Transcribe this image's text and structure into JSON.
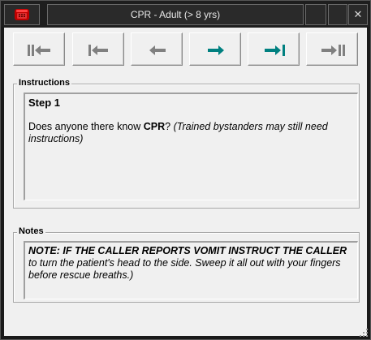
{
  "window": {
    "title": "CPR - Adult (> 8 yrs)",
    "close_glyph": "✕",
    "app_icon": "telephone-icon"
  },
  "nav": {
    "buttons": [
      {
        "name": "first-step-button",
        "icon": "double-bar-left-arrow-icon",
        "color": "#808080"
      },
      {
        "name": "previous-section-button",
        "icon": "bar-left-arrow-icon",
        "color": "#808080"
      },
      {
        "name": "previous-button",
        "icon": "left-arrow-icon",
        "color": "#808080"
      },
      {
        "name": "next-button",
        "icon": "right-arrow-icon",
        "color": "#008080"
      },
      {
        "name": "next-section-button",
        "icon": "right-arrow-bar-icon",
        "color": "#008080"
      },
      {
        "name": "last-step-button",
        "icon": "right-arrow-double-bar-icon",
        "color": "#808080"
      }
    ]
  },
  "instructions": {
    "label": "Instructions",
    "step": "Step 1",
    "question_prefix": "Does anyone there know ",
    "question_bold": "CPR",
    "question_suffix": "? ",
    "question_note": "(Trained bystanders may still need instructions)"
  },
  "notes": {
    "label": "Notes",
    "note_bold": "NOTE: IF THE CALLER REPORTS VOMIT INSTRUCT THE CALLER",
    "note_rest": " to turn the patient's head to the side.  Sweep it all out with your fingers before rescue breaths.)"
  }
}
